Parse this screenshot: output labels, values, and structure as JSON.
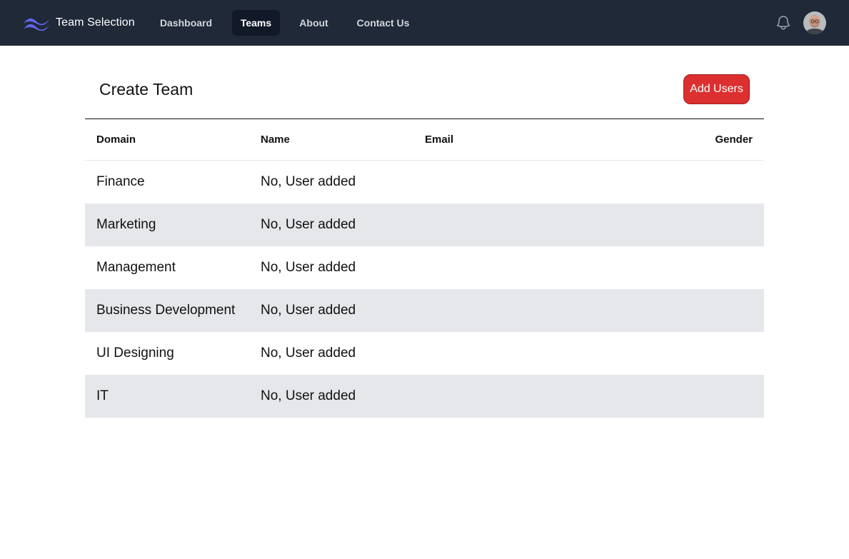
{
  "app": {
    "brand_name": "Team Selection",
    "brand_color": "#6366f1"
  },
  "nav": {
    "links": [
      {
        "label": "Dashboard",
        "active": false
      },
      {
        "label": "Teams",
        "active": true
      },
      {
        "label": "About",
        "active": false
      },
      {
        "label": "Contact Us",
        "active": false
      }
    ],
    "notifications_icon": "bell-icon",
    "avatar_icon": "user-avatar"
  },
  "page": {
    "title": "Create Team",
    "add_users_label": "Add Users",
    "add_users_color": "#dc2f2f"
  },
  "table": {
    "headers": {
      "domain": "Domain",
      "name": "Name",
      "email": "Email",
      "gender": "Gender"
    },
    "rows": [
      {
        "domain": "Finance",
        "name": "No, User added",
        "email": "",
        "gender": ""
      },
      {
        "domain": "Marketing",
        "name": "No, User added",
        "email": "",
        "gender": ""
      },
      {
        "domain": "Management",
        "name": "No, User added",
        "email": "",
        "gender": ""
      },
      {
        "domain": "Business Development",
        "name": "No, User added",
        "email": "",
        "gender": ""
      },
      {
        "domain": "UI Designing",
        "name": "No, User added",
        "email": "",
        "gender": ""
      },
      {
        "domain": "IT",
        "name": "No, User added",
        "email": "",
        "gender": ""
      }
    ]
  }
}
